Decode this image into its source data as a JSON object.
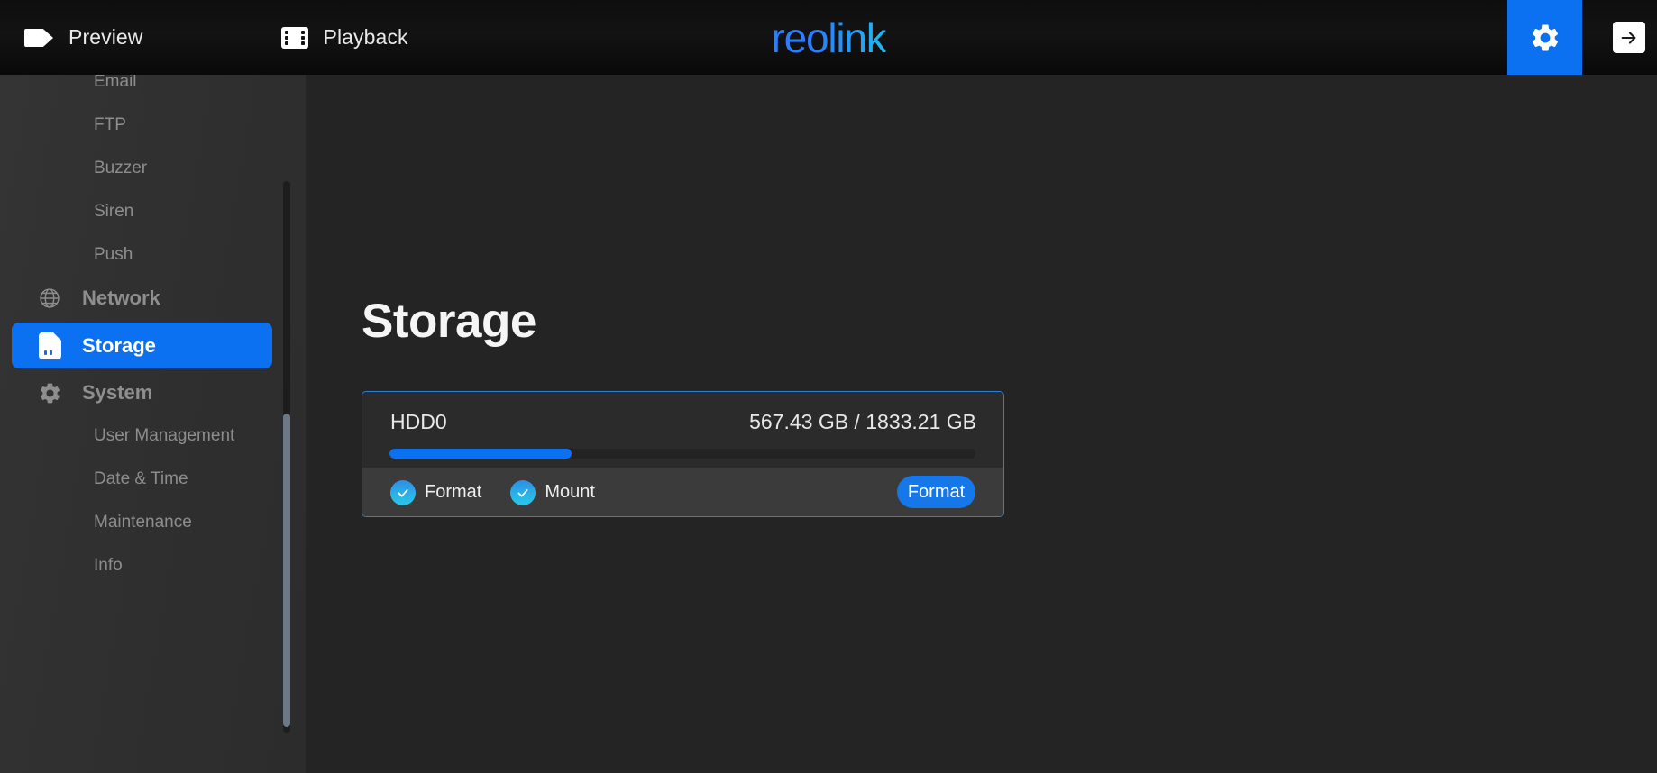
{
  "topbar": {
    "nav": [
      {
        "label": "Preview",
        "icon": "camera-icon"
      },
      {
        "label": "Playback",
        "icon": "film-strip-icon"
      }
    ],
    "brand": "reolink",
    "settings_icon": "gear-icon",
    "logout_icon": "arrow-right-icon"
  },
  "sidebar": {
    "items": [
      {
        "label": "Email",
        "type": "child",
        "icon": null,
        "active": false
      },
      {
        "label": "FTP",
        "type": "child",
        "icon": null,
        "active": false
      },
      {
        "label": "Buzzer",
        "type": "child",
        "icon": null,
        "active": false
      },
      {
        "label": "Siren",
        "type": "child",
        "icon": null,
        "active": false
      },
      {
        "label": "Push",
        "type": "child",
        "icon": null,
        "active": false
      },
      {
        "label": "Network",
        "type": "group",
        "icon": "globe-icon",
        "active": false
      },
      {
        "label": "Storage",
        "type": "group",
        "icon": "sd-card-icon",
        "active": true
      },
      {
        "label": "System",
        "type": "group",
        "icon": "gear-icon",
        "active": false
      },
      {
        "label": "User Management",
        "type": "child",
        "icon": null,
        "active": false
      },
      {
        "label": "Date & Time",
        "type": "child",
        "icon": null,
        "active": false
      },
      {
        "label": "Maintenance",
        "type": "child",
        "icon": null,
        "active": false
      },
      {
        "label": "Info",
        "type": "child",
        "icon": null,
        "active": false
      }
    ]
  },
  "main": {
    "page_title": "Storage",
    "hdd": {
      "name": "HDD0",
      "capacity_text": "567.43 GB / 1833.21 GB",
      "used_gb": 567.43,
      "total_gb": 1833.21,
      "used_percent": 31,
      "checkboxes": [
        {
          "label": "Format",
          "checked": true
        },
        {
          "label": "Mount",
          "checked": true
        }
      ],
      "action_button": "Format"
    }
  },
  "colors": {
    "accent_blue": "#0c71f0",
    "button_blue": "#1677e8",
    "check_cyan": "#27c6ea",
    "card_border": "#2f7fd6",
    "topbar_bg": "#111111",
    "sidebar_bg": "#303030",
    "main_bg": "#242424",
    "scrollbar_thumb": "#6b7886"
  }
}
